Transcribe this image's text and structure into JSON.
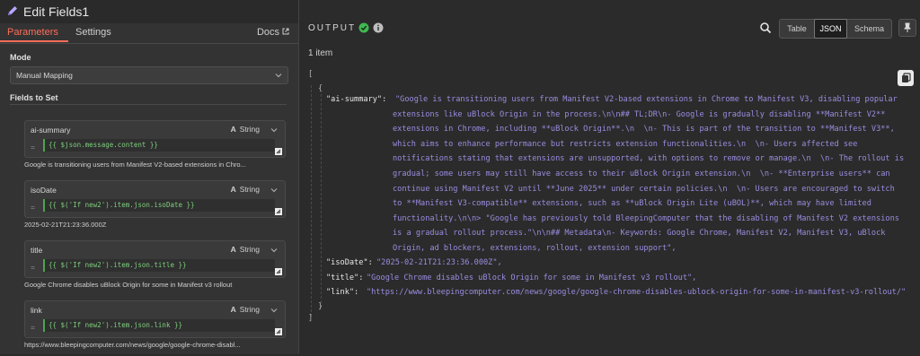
{
  "header": {
    "title": "Edit Fields1",
    "tabs": [
      {
        "label": "Parameters"
      },
      {
        "label": "Settings"
      }
    ],
    "docs_label": "Docs"
  },
  "mode": {
    "label": "Mode",
    "value": "Manual Mapping"
  },
  "fields_section": {
    "label": "Fields to Set"
  },
  "fields": [
    {
      "name": "ai-summary",
      "type": "String",
      "expression": "{{ $json.message.content }}",
      "preview": "Google is transitioning users from Manifest V2-based extensions in Chro..."
    },
    {
      "name": "isoDate",
      "type": "String",
      "expression": "{{ $('If new2').item.json.isoDate }}",
      "preview": "2025-02-21T21:23:36.000Z"
    },
    {
      "name": "title",
      "type": "String",
      "expression": "{{ $('If new2').item.json.title }}",
      "preview": "Google Chrome disables uBlock Origin for some in Manifest v3 rollout"
    },
    {
      "name": "link",
      "type": "String",
      "expression": "{{ $('If new2').item.json.link }}",
      "preview": "https://www.bleepingcomputer.com/news/google/google-chrome-disabl..."
    }
  ],
  "output": {
    "label": "OUTPUT",
    "item_count": "1 item",
    "view_tabs": [
      {
        "label": "Table"
      },
      {
        "label": "JSON"
      },
      {
        "label": "Schema"
      }
    ],
    "selected_view": "JSON",
    "json": {
      "open_bracket": "[",
      "open_brace": "{",
      "close_brace": "}",
      "close_bracket": "]",
      "summary_key": "\"ai-summary\": ",
      "summary_lines": [
        "\"Google is transitioning users from Manifest V2-based extensions in Chrome to Manifest V3, disabling popular",
        "extensions like uBlock Origin in the process.\\n\\n## TL;DR\\n- Google is gradually disabling **Manifest V2**",
        "extensions in Chrome, including **uBlock Origin**.\\n  \\n- This is part of the transition to **Manifest V3**,",
        "which aims to enhance performance but restricts extension functionalities.\\n  \\n- Users affected see",
        "notifications stating that extensions are unsupported, with options to remove or manage.\\n  \\n- The rollout is",
        "gradual; some users may still have access to their uBlock Origin extension.\\n  \\n- **Enterprise users** can",
        "continue using Manifest V2 until **June 2025** under certain policies.\\n  \\n- Users are encouraged to switch",
        "to **Manifest V3-compatible** extensions, such as **uBlock Origin Lite (uBOL)**, which may have limited",
        "functionality.\\n\\n> \"Google has previously told BleepingComputer that the disabling of Manifest V2 extensions",
        "is a gradual rollout process.\"\\n\\n## Metadata\\n- Keywords: Google Chrome, Manifest V2, Manifest V3, uBlock",
        "Origin, ad blockers, extensions, rollout, extension support\","
      ],
      "isoDate_key": "\"isoDate\": ",
      "isoDate_val": "\"2025-02-21T21:23:36.000Z\",",
      "title_key": "\"title\": ",
      "title_val": "\"Google Chrome disables uBlock Origin for some in Manifest v3 rollout\",",
      "link_key": "\"link\": ",
      "link_val": "\"https://www.bleepingcomputer.com/news/google/google-chrome-disables-ublock-origin-for-some-in-manifest-v3-rollout/\""
    }
  },
  "colors": {
    "accent": "#ff6d5a",
    "json_string": "#9c8ce0",
    "expression": "#7ecf7e",
    "success": "#3fb950"
  }
}
